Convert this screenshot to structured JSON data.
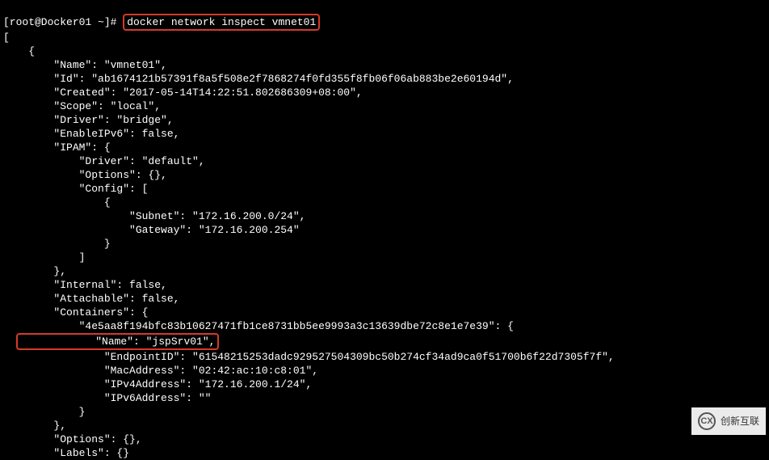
{
  "prompt_prefix": "[root@Docker01 ~]# ",
  "command": "docker network inspect vmnet01",
  "highlight2_line": "            \"Name\": \"jspSrv01\",",
  "output": {
    "l00": "[",
    "l01": "    {",
    "l02": "        \"Name\": \"vmnet01\",",
    "l03": "        \"Id\": \"ab1674121b57391f8a5f508e2f7868274f0fd355f8fb06f06ab883be2e60194d\",",
    "l04": "        \"Created\": \"2017-05-14T14:22:51.802686309+08:00\",",
    "l05": "        \"Scope\": \"local\",",
    "l06": "        \"Driver\": \"bridge\",",
    "l07": "        \"EnableIPv6\": false,",
    "l08": "        \"IPAM\": {",
    "l09": "            \"Driver\": \"default\",",
    "l10": "            \"Options\": {},",
    "l11": "            \"Config\": [",
    "l12": "                {",
    "l13": "                    \"Subnet\": \"172.16.200.0/24\",",
    "l14": "                    \"Gateway\": \"172.16.200.254\"",
    "l15": "                }",
    "l16": "            ]",
    "l17": "        },",
    "l18": "        \"Internal\": false,",
    "l19": "        \"Attachable\": false,",
    "l20": "        \"Containers\": {",
    "l21": "            \"4e5aa8f194bfc83b10627471fb1ce8731bb5ee9993a3c13639dbe72c8e1e7e39\": {",
    "l22_after": "",
    "l23": "                \"EndpointID\": \"61548215253dadc929527504309bc50b274cf34ad9ca0f51700b6f22d7305f7f\",",
    "l24": "                \"MacAddress\": \"02:42:ac:10:c8:01\",",
    "l25": "                \"IPv4Address\": \"172.16.200.1/24\",",
    "l26": "                \"IPv6Address\": \"\"",
    "l27": "            }",
    "l28": "        },",
    "l29": "        \"Options\": {},",
    "l30": "        \"Labels\": {}"
  },
  "watermark": "创新互联"
}
